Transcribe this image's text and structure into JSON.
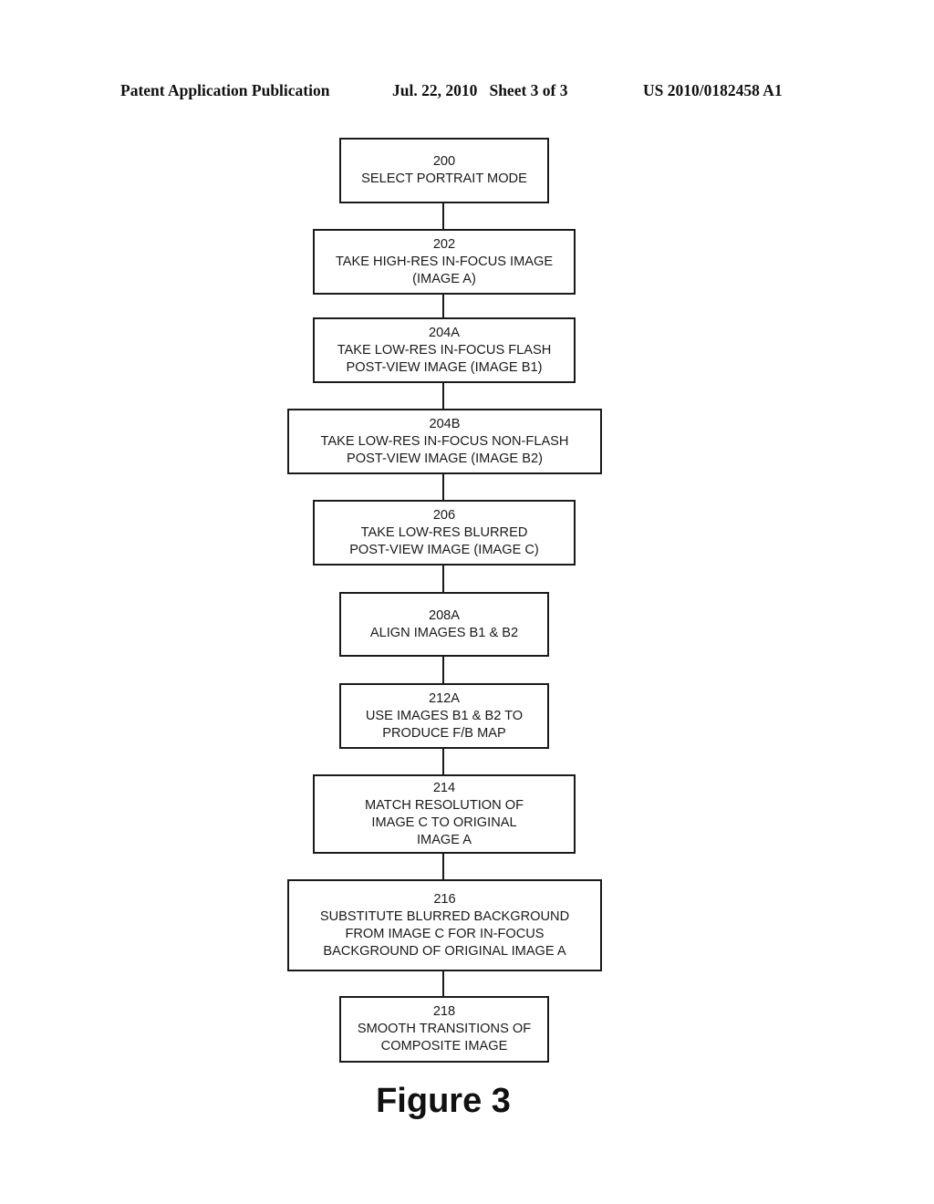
{
  "header": {
    "left": "Patent Application Publication",
    "middle": "Jul. 22, 2010   Sheet 3 of 3",
    "right": "US 2010/0182458 A1"
  },
  "flowchart": {
    "steps": [
      {
        "id": "200",
        "lines": [
          "200",
          "SELECT PORTRAIT MODE"
        ]
      },
      {
        "id": "202",
        "lines": [
          "202",
          "TAKE HIGH-RES IN-FOCUS IMAGE",
          "(IMAGE A)"
        ]
      },
      {
        "id": "204A",
        "lines": [
          "204A",
          "TAKE LOW-RES IN-FOCUS FLASH",
          "POST-VIEW IMAGE (IMAGE B1)"
        ]
      },
      {
        "id": "204B",
        "lines": [
          "204B",
          "TAKE LOW-RES IN-FOCUS NON-FLASH",
          "POST-VIEW IMAGE (IMAGE B2)"
        ]
      },
      {
        "id": "206",
        "lines": [
          "206",
          "TAKE LOW-RES BLURRED",
          "POST-VIEW IMAGE (IMAGE C)"
        ]
      },
      {
        "id": "208A",
        "lines": [
          "208A",
          "ALIGN IMAGES B1 & B2"
        ]
      },
      {
        "id": "212A",
        "lines": [
          "212A",
          "USE IMAGES B1 & B2 TO",
          "PRODUCE F/B MAP"
        ]
      },
      {
        "id": "214",
        "lines": [
          "214",
          "MATCH RESOLUTION OF",
          "IMAGE C TO ORIGINAL",
          "IMAGE A"
        ]
      },
      {
        "id": "216",
        "lines": [
          "216",
          "SUBSTITUTE BLURRED BACKGROUND",
          "FROM IMAGE C FOR IN-FOCUS",
          "BACKGROUND OF ORIGINAL IMAGE A"
        ]
      },
      {
        "id": "218",
        "lines": [
          "218",
          "SMOOTH TRANSITIONS OF",
          "COMPOSITE IMAGE"
        ]
      }
    ],
    "edges": [
      [
        "200",
        "202"
      ],
      [
        "202",
        "204A"
      ],
      [
        "204A",
        "204B"
      ],
      [
        "204B",
        "206"
      ],
      [
        "206",
        "208A"
      ],
      [
        "208A",
        "212A"
      ],
      [
        "212A",
        "214"
      ],
      [
        "214",
        "216"
      ],
      [
        "216",
        "218"
      ]
    ]
  },
  "caption": "Figure 3"
}
